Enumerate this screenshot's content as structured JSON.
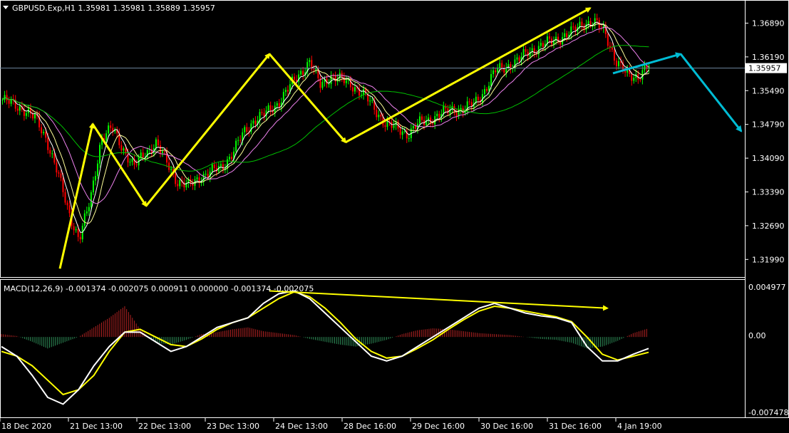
{
  "header": {
    "symbol_line": "GBPUSD.Exp,H1  1.35981 1.35981 1.35889 1.35957"
  },
  "macd": {
    "label": "MACD(12,26,9) -0.001374 -0.002075 0.000911 0.000000 -0.001374 -0.002075",
    "y_ticks": [
      "0.004977",
      "0.00",
      "-0.007478"
    ]
  },
  "colors": {
    "background": "#000000",
    "grid_border": "#ffffff",
    "bull_candle": "#00ff00",
    "bear_candle": "#ff0000",
    "ma_white": "#ffffff",
    "ma_yellow": "#ffff99",
    "ma_violet": "#ee82ee",
    "ma_green": "#00c000",
    "pattern_arrows": "#ffff00",
    "forecast_arrows": "#00bcd4",
    "macd_hist_pos": "#b22222",
    "macd_hist_neg": "#2e8b57",
    "macd_line": "#ffffff",
    "signal_line": "#ffff00",
    "current_price_line": "#6f87a0"
  },
  "chart_data": [
    {
      "type": "candlestick",
      "title": "GBPUSD.Exp,H1",
      "ohlc_last": {
        "open": 1.35981,
        "high": 1.35981,
        "low": 1.35889,
        "close": 1.35957
      },
      "current_price": "1.35957",
      "y_ticks": [
        "1.36890",
        "1.36190",
        "1.35490",
        "1.34790",
        "1.34090",
        "1.33390",
        "1.32690",
        "1.31990"
      ],
      "ylim": [
        1.3164,
        1.3734
      ],
      "x_ticks": [
        "18 Dec 2020",
        "21 Dec 13:00",
        "22 Dec 13:00",
        "23 Dec 13:00",
        "24 Dec 13:00",
        "28 Dec 16:00",
        "29 Dec 16:00",
        "30 Dec 16:00",
        "31 Dec 16:00",
        "4 Jan 19:00"
      ],
      "price_path": [
        1.353,
        1.352,
        1.351,
        1.349,
        1.345,
        1.338,
        1.33,
        1.324,
        1.332,
        1.345,
        1.347,
        1.343,
        1.339,
        1.342,
        1.344,
        1.34,
        1.336,
        1.335,
        1.337,
        1.338,
        1.339,
        1.342,
        1.346,
        1.349,
        1.35,
        1.352,
        1.355,
        1.358,
        1.361,
        1.356,
        1.358,
        1.357,
        1.356,
        1.354,
        1.351,
        1.348,
        1.347,
        1.346,
        1.348,
        1.349,
        1.35,
        1.351,
        1.351,
        1.352,
        1.355,
        1.359,
        1.36,
        1.361,
        1.363,
        1.364,
        1.365,
        1.366,
        1.367,
        1.369,
        1.369,
        1.367,
        1.361,
        1.358,
        1.358,
        1.36
      ],
      "pattern_arrows": [
        {
          "from": [
            0,
            1.318
          ],
          "to": [
            1,
            1.348
          ]
        },
        {
          "from": [
            1,
            1.348
          ],
          "to": [
            2,
            1.331
          ]
        },
        {
          "from": [
            2,
            1.331
          ],
          "to": [
            3,
            1.3625
          ]
        },
        {
          "from": [
            3,
            1.3625
          ],
          "to": [
            4,
            1.3442
          ]
        },
        {
          "from": [
            4,
            1.3442
          ],
          "to": [
            5,
            1.372
          ]
        }
      ],
      "forecast_arrows": [
        {
          "from": [
            6,
            1.3585
          ],
          "to": [
            7,
            1.3625
          ]
        },
        {
          "from": [
            7,
            1.3625
          ],
          "to": [
            8,
            1.3465
          ]
        }
      ]
    },
    {
      "type": "macd",
      "title": "MACD(12,26,9)",
      "values": {
        "main": -0.001374,
        "signal": -0.002075
      },
      "ylim": [
        -0.0083,
        0.0058
      ],
      "macd_line": [
        -0.001,
        -0.002,
        -0.004,
        -0.0063,
        -0.007,
        -0.0055,
        -0.003,
        -0.001,
        0.0005,
        0.0005,
        -0.0005,
        -0.0015,
        -0.001,
        0.0,
        0.001,
        0.0015,
        0.002,
        0.0035,
        0.0045,
        0.0048,
        0.004,
        0.0025,
        0.001,
        -0.0005,
        -0.002,
        -0.0025,
        -0.002,
        -0.001,
        0.0,
        0.001,
        0.002,
        0.003,
        0.0035,
        0.003,
        0.0025,
        0.0022,
        0.002,
        0.0015,
        -0.001,
        -0.0025,
        -0.0025,
        -0.0018,
        -0.0012
      ],
      "signal_line": [
        -0.0015,
        -0.002,
        -0.003,
        -0.0045,
        -0.006,
        -0.0055,
        -0.004,
        -0.0015,
        0.0005,
        0.0008,
        0.0,
        -0.0008,
        -0.001,
        -0.0002,
        0.0008,
        0.0015,
        0.002,
        0.003,
        0.004,
        0.0047,
        0.0042,
        0.003,
        0.0015,
        -0.0002,
        -0.0015,
        -0.0022,
        -0.002,
        -0.0012,
        -0.0003,
        0.0008,
        0.0018,
        0.0027,
        0.0032,
        0.003,
        0.0027,
        0.0024,
        0.0021,
        0.0016,
        0.0,
        -0.0018,
        -0.0024,
        -0.002,
        -0.0016
      ],
      "histogram": [
        0.0003,
        0.0001,
        -0.0005,
        -0.0012,
        -0.0006,
        0.0,
        0.001,
        0.002,
        0.0032,
        0.0008,
        -0.0006,
        -0.0008,
        -0.0003,
        0.0003,
        0.0005,
        0.0008,
        0.001,
        0.0006,
        0.0004,
        0.0002,
        -0.0002,
        -0.0005,
        -0.0008,
        -0.001,
        -0.0007,
        -0.0003,
        0.0003,
        0.0007,
        0.0009,
        0.0008,
        0.0006,
        0.0004,
        0.0003,
        0.0002,
        0.0,
        -0.0002,
        -0.0003,
        -0.0006,
        -0.0012,
        -0.001,
        -0.0004,
        0.0004,
        0.0009
      ],
      "trend_arrow": {
        "from": [
          0,
          0.0048
        ],
        "to": [
          1,
          0.003
        ]
      }
    }
  ]
}
